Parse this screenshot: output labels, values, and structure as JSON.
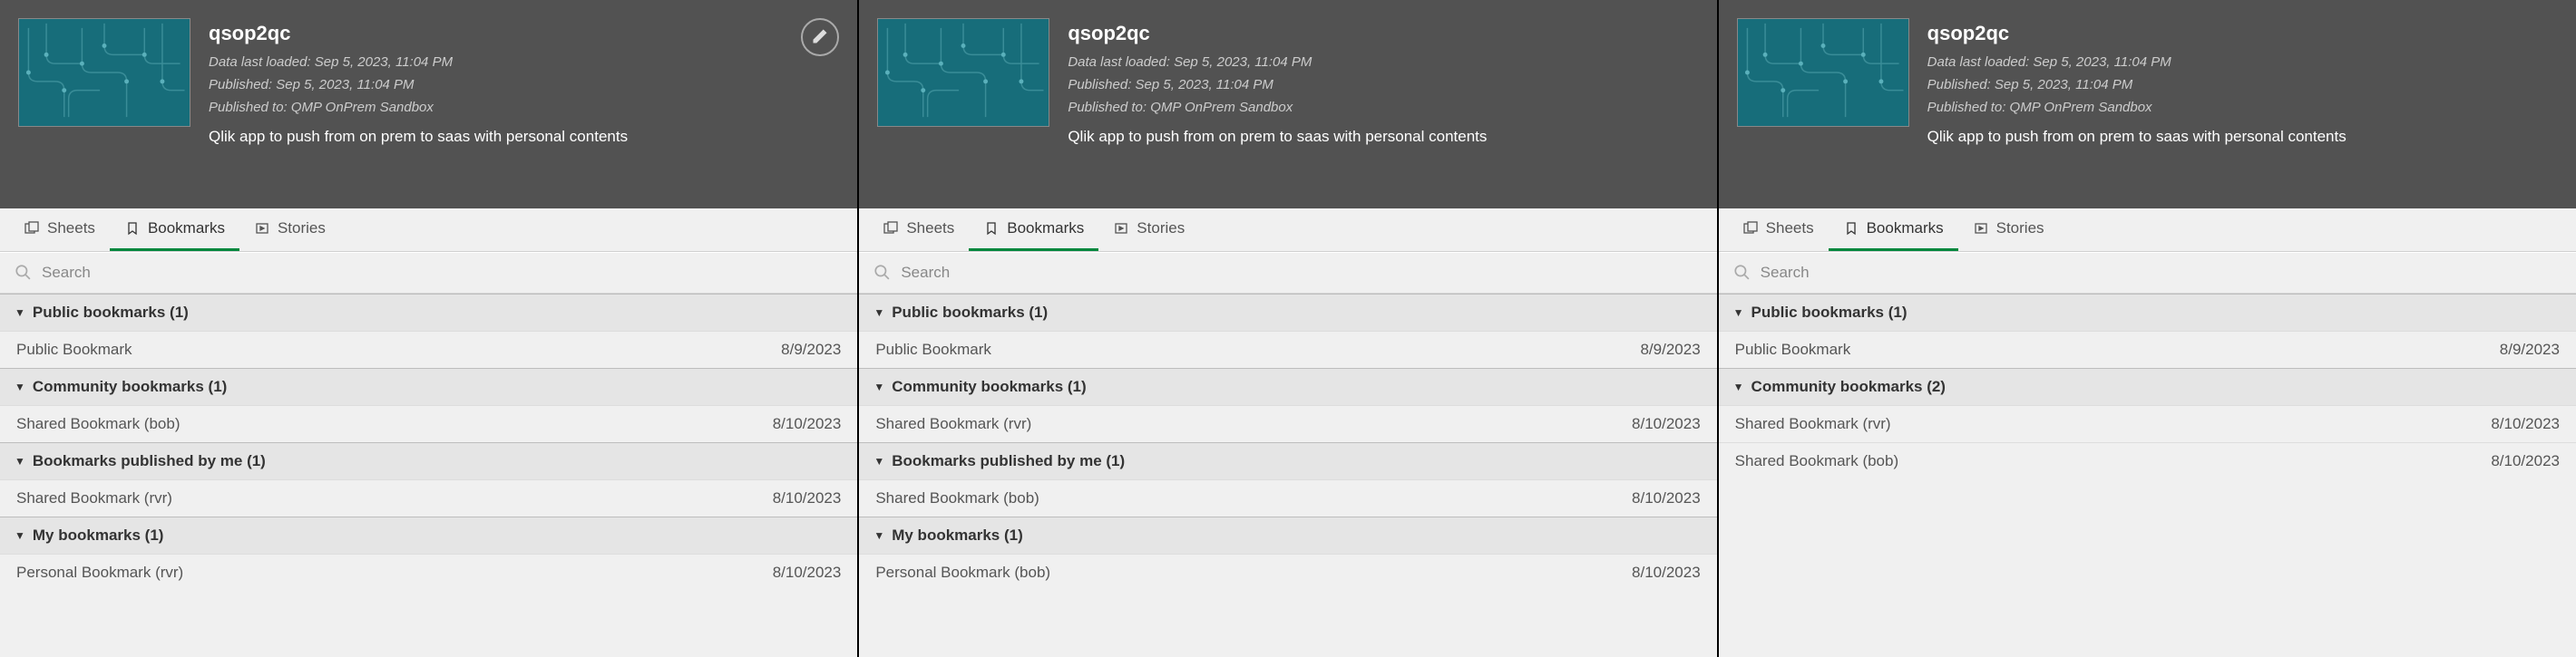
{
  "panels": [
    {
      "app_title": "qsop2qc",
      "meta_loaded": "Data last loaded: Sep 5, 2023, 11:04 PM",
      "meta_published": "Published: Sep 5, 2023, 11:04 PM",
      "meta_published_to": "Published to: QMP OnPrem Sandbox",
      "description": "Qlik app to push from on prem to saas with personal contents",
      "show_edit": true,
      "tabs": {
        "sheets": "Sheets",
        "bookmarks": "Bookmarks",
        "stories": "Stories",
        "active": "bookmarks"
      },
      "search_placeholder": "Search",
      "sections": [
        {
          "title": "Public bookmarks (1)",
          "rows": [
            {
              "name": "Public Bookmark",
              "date": "8/9/2023"
            }
          ]
        },
        {
          "title": "Community bookmarks (1)",
          "rows": [
            {
              "name": "Shared Bookmark (bob)",
              "date": "8/10/2023"
            }
          ]
        },
        {
          "title": "Bookmarks published by me (1)",
          "rows": [
            {
              "name": "Shared Bookmark (rvr)",
              "date": "8/10/2023"
            }
          ]
        },
        {
          "title": "My bookmarks (1)",
          "rows": [
            {
              "name": "Personal Bookmark (rvr)",
              "date": "8/10/2023"
            }
          ]
        }
      ]
    },
    {
      "app_title": "qsop2qc",
      "meta_loaded": "Data last loaded: Sep 5, 2023, 11:04 PM",
      "meta_published": "Published: Sep 5, 2023, 11:04 PM",
      "meta_published_to": "Published to: QMP OnPrem Sandbox",
      "description": "Qlik app to push from on prem to saas with personal contents",
      "show_edit": false,
      "tabs": {
        "sheets": "Sheets",
        "bookmarks": "Bookmarks",
        "stories": "Stories",
        "active": "bookmarks"
      },
      "search_placeholder": "Search",
      "sections": [
        {
          "title": "Public bookmarks (1)",
          "rows": [
            {
              "name": "Public Bookmark",
              "date": "8/9/2023"
            }
          ]
        },
        {
          "title": "Community bookmarks (1)",
          "rows": [
            {
              "name": "Shared Bookmark (rvr)",
              "date": "8/10/2023"
            }
          ]
        },
        {
          "title": "Bookmarks published by me (1)",
          "rows": [
            {
              "name": "Shared Bookmark (bob)",
              "date": "8/10/2023"
            }
          ]
        },
        {
          "title": "My bookmarks (1)",
          "rows": [
            {
              "name": "Personal Bookmark (bob)",
              "date": "8/10/2023"
            }
          ]
        }
      ]
    },
    {
      "app_title": "qsop2qc",
      "meta_loaded": "Data last loaded: Sep 5, 2023, 11:04 PM",
      "meta_published": "Published: Sep 5, 2023, 11:04 PM",
      "meta_published_to": "Published to: QMP OnPrem Sandbox",
      "description": "Qlik app to push from on prem to saas with personal contents",
      "show_edit": false,
      "tabs": {
        "sheets": "Sheets",
        "bookmarks": "Bookmarks",
        "stories": "Stories",
        "active": "bookmarks"
      },
      "search_placeholder": "Search",
      "sections": [
        {
          "title": "Public bookmarks (1)",
          "rows": [
            {
              "name": "Public Bookmark",
              "date": "8/9/2023"
            }
          ]
        },
        {
          "title": "Community bookmarks (2)",
          "rows": [
            {
              "name": "Shared Bookmark (rvr)",
              "date": "8/10/2023"
            },
            {
              "name": "Shared Bookmark (bob)",
              "date": "8/10/2023"
            }
          ]
        }
      ]
    }
  ]
}
